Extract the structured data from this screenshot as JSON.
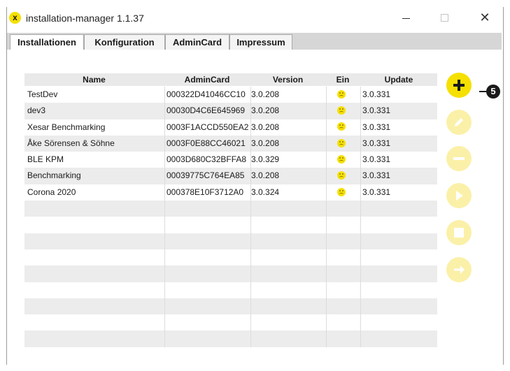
{
  "window": {
    "title": "installation-manager 1.1.37",
    "app_icon": "x-logo-icon",
    "close_glyph": "✕",
    "app_icon_glyph": "x"
  },
  "tabs": [
    {
      "label": "Installationen",
      "active": true
    },
    {
      "label": "Konfiguration",
      "active": false
    },
    {
      "label": "AdminCard",
      "active": false
    },
    {
      "label": "Impressum",
      "active": false
    }
  ],
  "table": {
    "columns": [
      "Name",
      "AdminCard",
      "Version",
      "Ein",
      "Update"
    ],
    "rows": [
      {
        "name": "TestDev",
        "admincard": "000322D41046CC10",
        "version": "3.0.208",
        "ein": "sad-smiley-icon",
        "update": "3.0.331"
      },
      {
        "name": "dev3",
        "admincard": "00030D4C6E645969",
        "version": "3.0.208",
        "ein": "sad-smiley-icon",
        "update": "3.0.331"
      },
      {
        "name": "Xesar Benchmarking",
        "admincard": "0003F1ACCD550EA2",
        "version": "3.0.208",
        "ein": "sad-smiley-icon",
        "update": "3.0.331"
      },
      {
        "name": "Åke Sörensen & Söhne",
        "admincard": "0003F0E88CC46021",
        "version": "3.0.208",
        "ein": "sad-smiley-icon",
        "update": "3.0.331"
      },
      {
        "name": "BLE KPM",
        "admincard": "0003D680C32BFFA8",
        "version": "3.0.329",
        "ein": "sad-smiley-icon",
        "update": "3.0.331"
      },
      {
        "name": "Benchmarking",
        "admincard": "00039775C764EA85",
        "version": "3.0.208",
        "ein": "sad-smiley-icon",
        "update": "3.0.331"
      },
      {
        "name": "Corona 2020",
        "admincard": "000378E10F3712A0",
        "version": "3.0.324",
        "ein": "sad-smiley-icon",
        "update": "3.0.331"
      }
    ],
    "empty_rows": 9
  },
  "actions": [
    {
      "name": "add",
      "icon": "plus-icon",
      "enabled": true
    },
    {
      "name": "edit",
      "icon": "pencil-icon",
      "enabled": false
    },
    {
      "name": "remove",
      "icon": "minus-icon",
      "enabled": false
    },
    {
      "name": "start",
      "icon": "play-icon",
      "enabled": false
    },
    {
      "name": "stop",
      "icon": "stop-icon",
      "enabled": false
    },
    {
      "name": "next",
      "icon": "arrow-right-icon",
      "enabled": false
    }
  ],
  "callout": {
    "number": "5"
  },
  "colors": {
    "accent": "#f5e000",
    "accent_disabled": "#fbf0a8",
    "icon_dark": "#1a1a1a",
    "icon_disabled": "#ffffff"
  }
}
